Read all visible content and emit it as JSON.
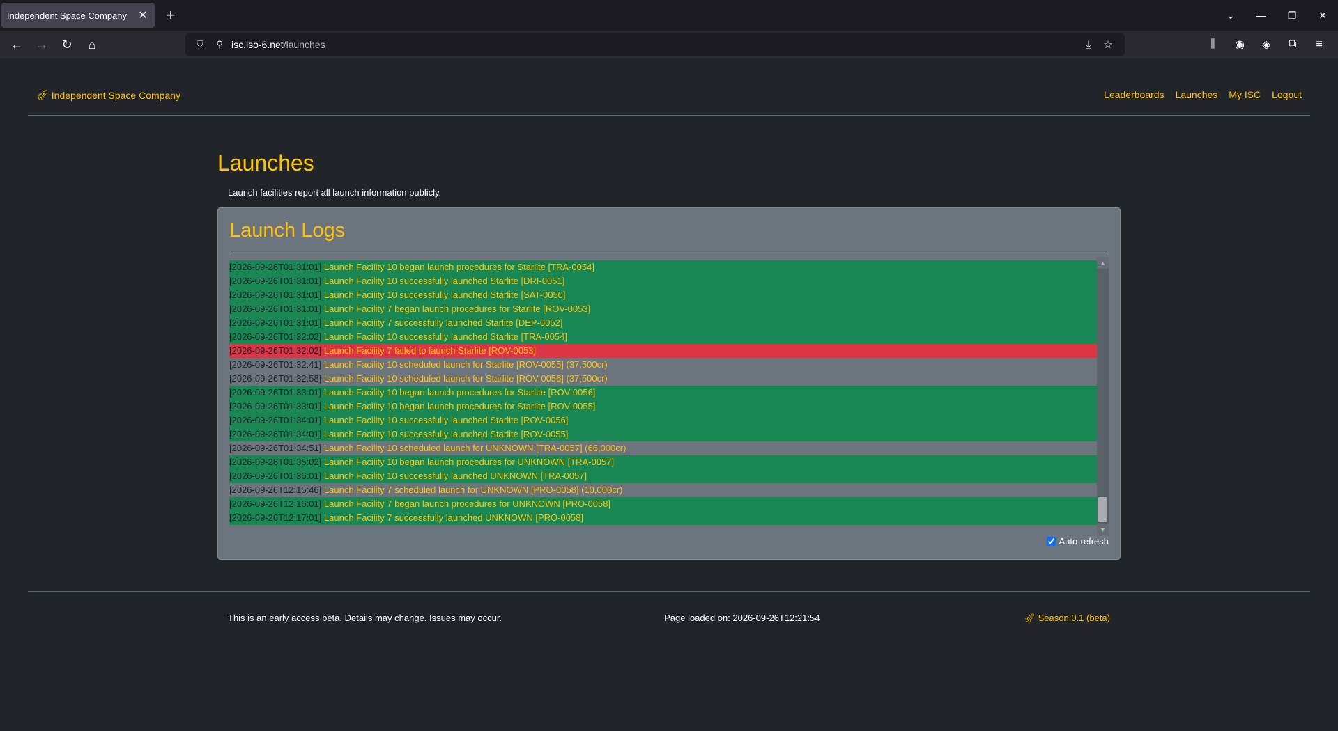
{
  "browser": {
    "tab_title": "Independent Space Company",
    "url_host": "isc.iso-6.net",
    "url_path": "/launches"
  },
  "header": {
    "brand": "Independent Space Company",
    "nav": [
      "Leaderboards",
      "Launches",
      "My ISC",
      "Logout"
    ]
  },
  "main": {
    "title": "Launches",
    "subtitle": "Launch facilities report all launch information publicly.",
    "card_title": "Launch Logs",
    "autorefresh_label": "Auto-refresh",
    "autorefresh_checked": true
  },
  "logs": [
    {
      "ts": "[2026-09-26T01:31:01]",
      "msg": "Launch Facility 10 began launch procedures for Starlite [TRA-0054]",
      "status": "success"
    },
    {
      "ts": "[2026-09-26T01:31:01]",
      "msg": "Launch Facility 10 successfully launched Starlite [DRI-0051]",
      "status": "success"
    },
    {
      "ts": "[2026-09-26T01:31:01]",
      "msg": "Launch Facility 10 successfully launched Starlite [SAT-0050]",
      "status": "success"
    },
    {
      "ts": "[2026-09-26T01:31:01]",
      "msg": "Launch Facility 7 began launch procedures for Starlite [ROV-0053]",
      "status": "success"
    },
    {
      "ts": "[2026-09-26T01:31:01]",
      "msg": "Launch Facility 7 successfully launched Starlite [DEP-0052]",
      "status": "success"
    },
    {
      "ts": "[2026-09-26T01:32:02]",
      "msg": "Launch Facility 10 successfully launched Starlite [TRA-0054]",
      "status": "success"
    },
    {
      "ts": "[2026-09-26T01:32:02]",
      "msg": "Launch Facility 7 failed to launch Starlite [ROV-0053]",
      "status": "danger"
    },
    {
      "ts": "[2026-09-26T01:32:41]",
      "msg": "Launch Facility 10 scheduled launch for Starlite [ROV-0055] (37,500cr)",
      "status": "neutral"
    },
    {
      "ts": "[2026-09-26T01:32:58]",
      "msg": "Launch Facility 10 scheduled launch for Starlite [ROV-0056] (37,500cr)",
      "status": "neutral"
    },
    {
      "ts": "[2026-09-26T01:33:01]",
      "msg": "Launch Facility 10 began launch procedures for Starlite [ROV-0056]",
      "status": "success"
    },
    {
      "ts": "[2026-09-26T01:33:01]",
      "msg": "Launch Facility 10 began launch procedures for Starlite [ROV-0055]",
      "status": "success"
    },
    {
      "ts": "[2026-09-26T01:34:01]",
      "msg": "Launch Facility 10 successfully launched Starlite [ROV-0056]",
      "status": "success"
    },
    {
      "ts": "[2026-09-26T01:34:01]",
      "msg": "Launch Facility 10 successfully launched Starlite [ROV-0055]",
      "status": "success"
    },
    {
      "ts": "[2026-09-26T01:34:51]",
      "msg": "Launch Facility 10 scheduled launch for UNKNOWN [TRA-0057] (66,000cr)",
      "status": "neutral"
    },
    {
      "ts": "[2026-09-26T01:35:02]",
      "msg": "Launch Facility 10 began launch procedures for UNKNOWN [TRA-0057]",
      "status": "success"
    },
    {
      "ts": "[2026-09-26T01:36:01]",
      "msg": "Launch Facility 10 successfully launched UNKNOWN [TRA-0057]",
      "status": "success"
    },
    {
      "ts": "[2026-09-26T12:15:46]",
      "msg": "Launch Facility 7 scheduled launch for UNKNOWN [PRO-0058] (10,000cr)",
      "status": "neutral"
    },
    {
      "ts": "[2026-09-26T12:16:01]",
      "msg": "Launch Facility 7 began launch procedures for UNKNOWN [PRO-0058]",
      "status": "success"
    },
    {
      "ts": "[2026-09-26T12:17:01]",
      "msg": "Launch Facility 7 successfully launched UNKNOWN [PRO-0058]",
      "status": "success"
    }
  ],
  "footer": {
    "beta_notice": "This is an early access beta. Details may change. Issues may occur.",
    "loaded": "Page loaded on: 2026-09-26T12:21:54",
    "season": "Season 0.1 (beta)"
  }
}
